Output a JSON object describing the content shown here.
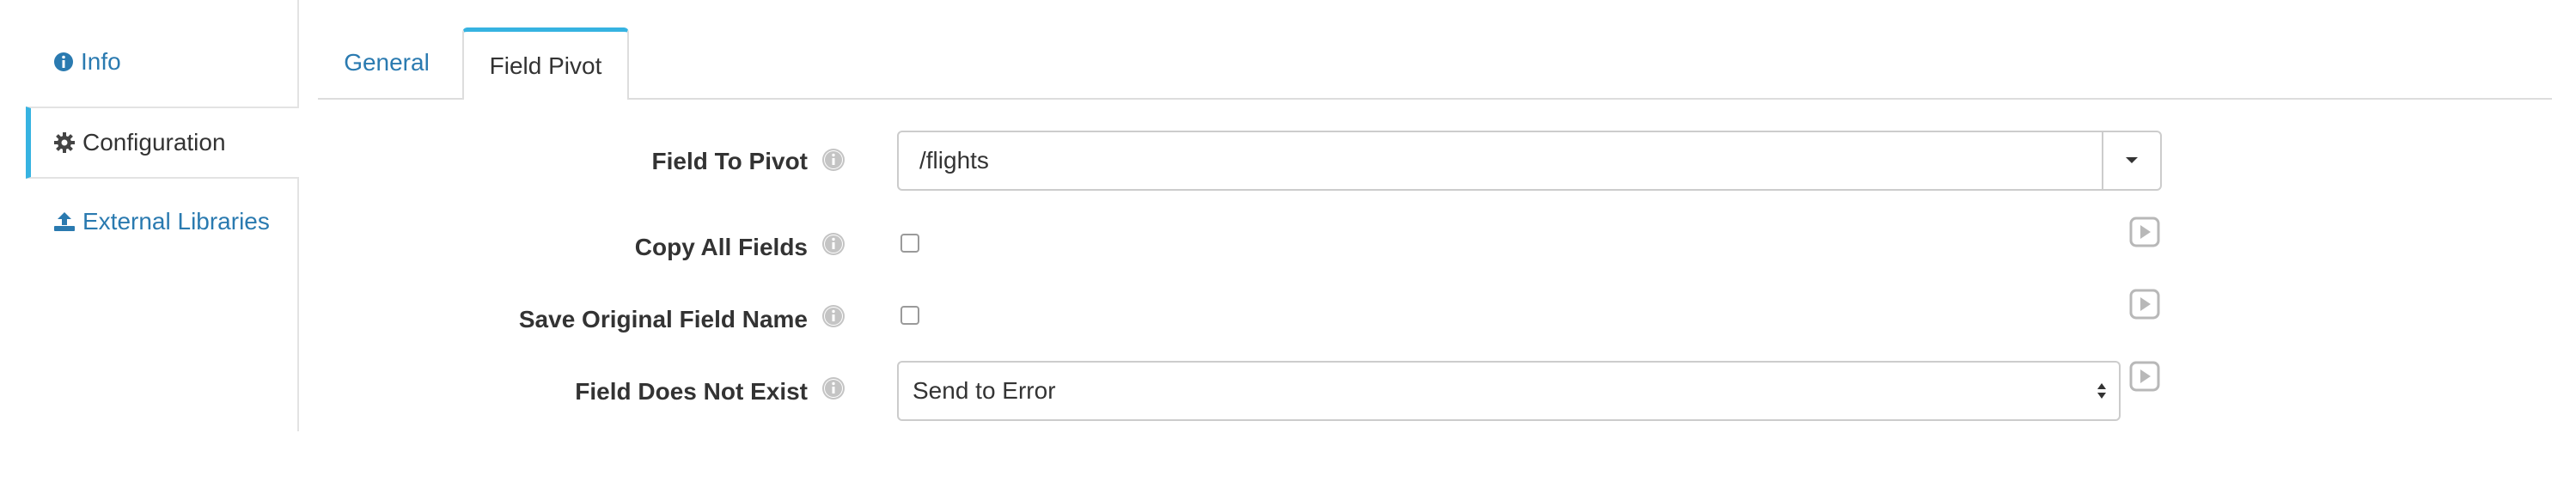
{
  "sidebar": {
    "items": [
      {
        "label": "Info",
        "icon": "info-circle-icon"
      },
      {
        "label": "Configuration",
        "icon": "gear-icon"
      },
      {
        "label": "External Libraries",
        "icon": "upload-icon"
      }
    ],
    "active_index": 1
  },
  "tabs": [
    {
      "label": "General",
      "active": false
    },
    {
      "label": "Field Pivot",
      "active": true
    }
  ],
  "form": {
    "field_to_pivot": {
      "label": "Field To Pivot",
      "value": "/flights"
    },
    "copy_all_fields": {
      "label": "Copy All Fields",
      "checked": false
    },
    "save_original_field_name": {
      "label": "Save Original Field Name",
      "checked": false
    },
    "field_does_not_exist": {
      "label": "Field Does Not Exist",
      "value": "Send to Error"
    }
  },
  "colors": {
    "accent": "#36b3e1",
    "link": "#2a7ab0",
    "text": "#333333",
    "border": "#cccccc",
    "icon_gray": "#b8b8b8"
  }
}
